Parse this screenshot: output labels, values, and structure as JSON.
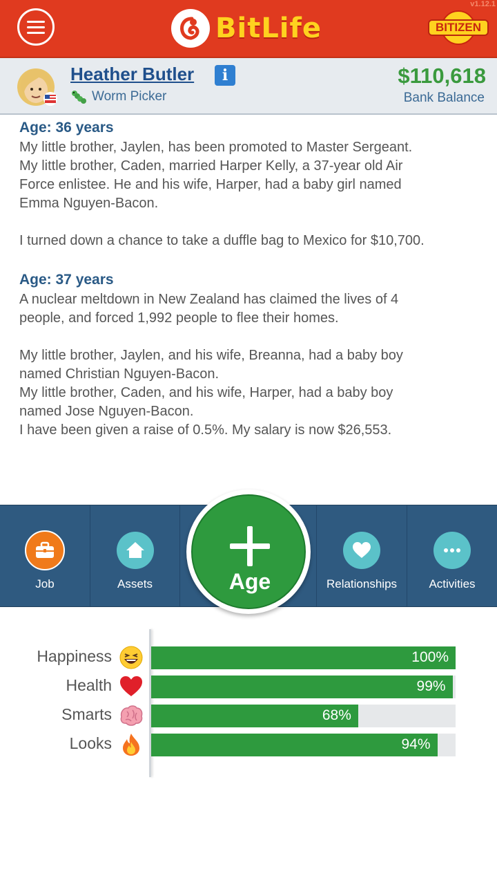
{
  "header": {
    "logo_text": "BitLife",
    "badge": "BITIZEN",
    "version": "v1.12.1",
    "colors": {
      "bar": "#e03a1f",
      "logo": "#ffd21f"
    }
  },
  "profile": {
    "name": "Heather Butler",
    "job": "Worm Picker",
    "balance": "$110,618",
    "balance_label": "Bank Balance"
  },
  "log": {
    "age36": {
      "heading": "Age: 36 years",
      "lines": [
        "My little brother, Jaylen, has been promoted to Master Sergeant.",
        "My little brother, Caden, married Harper Kelly, a 37-year old Air",
        "Force enlistee. He and his wife, Harper, had a baby girl named",
        "Emma Nguyen-Bacon.",
        "I turned down a chance to take a duffle bag to Mexico for $10,700."
      ]
    },
    "age37": {
      "heading": "Age: 37 years",
      "lines": [
        "A nuclear meltdown in New Zealand has claimed the lives of 4",
        "people, and forced 1,992 people to flee their homes.",
        "My little brother, Jaylen, and his wife, Breanna, had a baby boy",
        "named Christian Nguyen-Bacon.",
        "My little brother, Caden, and his wife, Harper, had a baby boy",
        "named Jose Nguyen-Bacon.",
        "I have been given a raise of 0.5%. My salary is now $26,553."
      ]
    }
  },
  "nav": {
    "job": "Job",
    "assets": "Assets",
    "age": "Age",
    "relationships": "Relationships",
    "activities": "Activities"
  },
  "stats": [
    {
      "label": "Happiness",
      "value_text": "100%",
      "value": 100,
      "emoji": "laughing-face-icon"
    },
    {
      "label": "Health",
      "value_text": "99%",
      "value": 99,
      "emoji": "heart-icon"
    },
    {
      "label": "Smarts",
      "value_text": "68%",
      "value": 68,
      "emoji": "brain-icon"
    },
    {
      "label": "Looks",
      "value_text": "94%",
      "value": 94,
      "emoji": "fire-icon"
    }
  ]
}
